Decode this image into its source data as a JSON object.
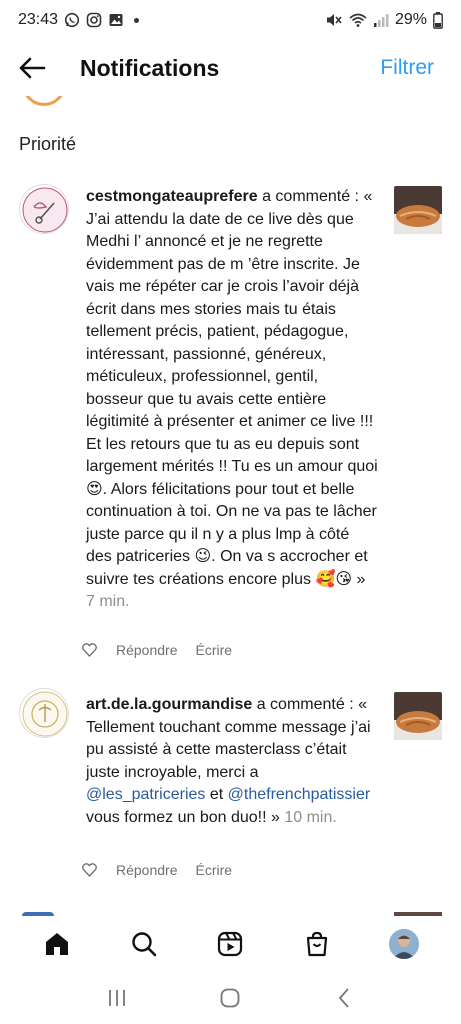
{
  "status_bar": {
    "time": "23:43",
    "battery": "29%",
    "left_icons": [
      "whatsapp-icon",
      "instagram-icon",
      "gallery-icon"
    ],
    "right_icons": [
      "mute-icon",
      "wifi-icon",
      "signal-icon",
      "battery-icon"
    ]
  },
  "header": {
    "title": "Notifications",
    "filter_label": "Filtrer"
  },
  "section": {
    "title": "Priorité"
  },
  "notifications": [
    {
      "username": "cestmongateauprefere",
      "action": " a commenté : ",
      "text_before_mention": "« J’ai attendu la date de ce live dès que Medhi l’ annoncé et je ne regrette évidemment pas de m ’être inscrite. Je vais me répéter car je crois l’avoir déjà écrit dans mes stories mais tu étais tellement précis, patient, pédagogue, intéressant, passionné, généreux, méticuleux, professionnel, gentil, bosseur que tu avais cette entière légitimité à présenter et animer ce live !!! Et les retours que tu as eu depuis sont largement mérités !! Tu es un amour quoi 😍. Alors félicitations pour tout et belle continuation à toi. On ne va pas te lâcher juste parce qu il n y a plus lmp à côté des patriceries 😉. On va s accrocher et suivre tes créations encore plus 🥰😘 » ",
      "timestamp": "7 min.",
      "reply_label": "Répondre",
      "write_label": "Écrire"
    },
    {
      "username": "art.de.la.gourmandise",
      "action": " a commenté : ",
      "text_before_mention": "« Tellement touchant comme message j’ai pu assisté à cette masterclass c’était juste incroyable, merci a ",
      "mention_1": "@les_patriceries",
      "text_between": " et ",
      "mention_2": "@thefrenchpatissier",
      "text_after": " vous formez un bon duo!! » ",
      "timestamp": "10 min.",
      "reply_label": "Répondre",
      "write_label": "Écrire"
    }
  ],
  "bottom_nav": [
    "home-icon",
    "search-icon",
    "reels-icon",
    "shop-icon",
    "profile-avatar"
  ],
  "colors": {
    "accent": "#2a9df4",
    "mention": "#2a5c9a",
    "muted": "#8e8e8e"
  }
}
